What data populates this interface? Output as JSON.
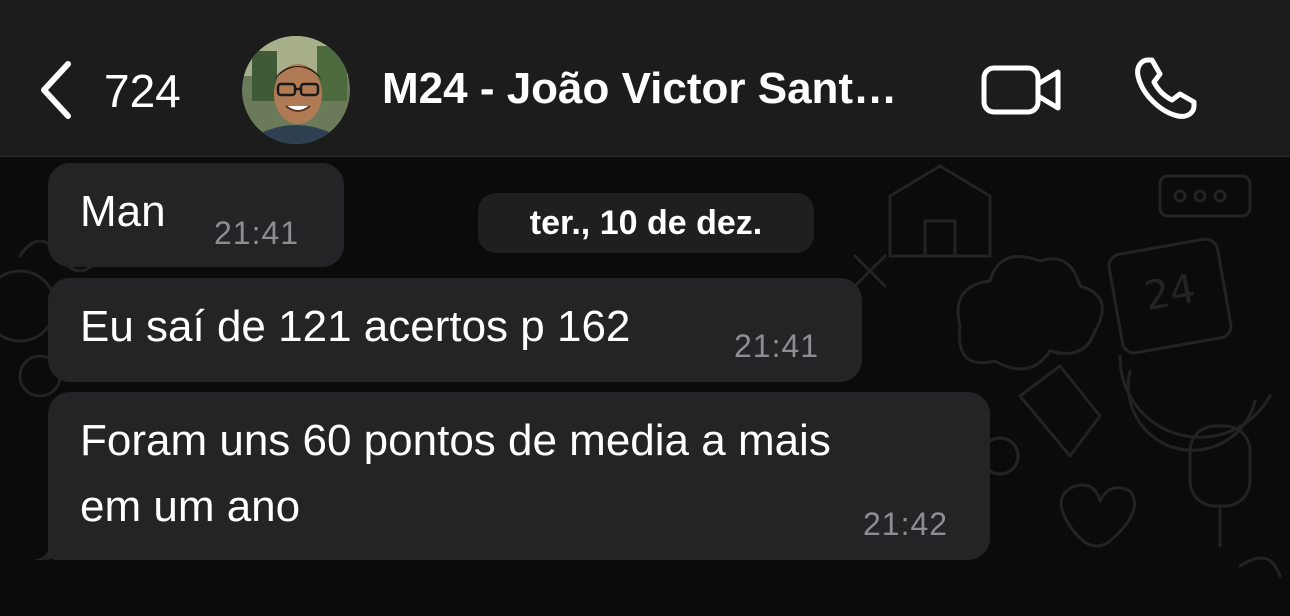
{
  "header": {
    "back_count": "724",
    "contact_name": "M24 - João Victor Sant…"
  },
  "date_separator": "ter., 10 de dez.",
  "messages": [
    {
      "text": "Man",
      "time": "21:41"
    },
    {
      "text": "Eu saí de 121 acertos p 162",
      "time": "21:41"
    },
    {
      "text_line1": "Foram uns 60 pontos de media a mais",
      "text_line2": "em um ano",
      "time": "21:42"
    }
  ],
  "colors": {
    "header_bg": "#1c1c1d",
    "bubble_bg": "#242426",
    "time_text": "#8d8d92",
    "background": "#0b0b0b"
  },
  "icons": [
    "chevron-left-icon",
    "video-camera-icon",
    "phone-icon"
  ]
}
